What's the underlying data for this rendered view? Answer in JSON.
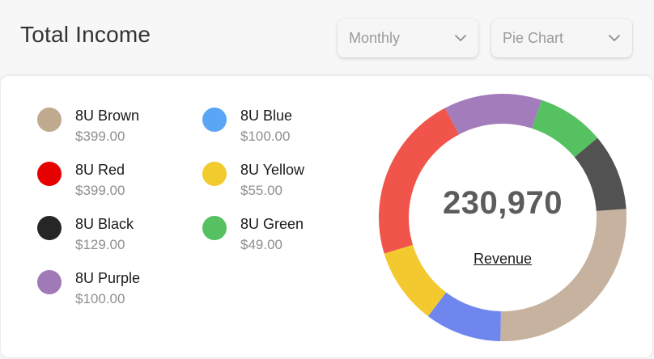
{
  "header": {
    "title": "Total Income"
  },
  "filters": {
    "period": "Monthly",
    "chart_type": "Pie Chart"
  },
  "legend": [
    {
      "name": "8U Brown",
      "price": "$399.00",
      "color": "#bfa98f"
    },
    {
      "name": "8U Red",
      "price": "$399.00",
      "color": "#e60000"
    },
    {
      "name": "8U Black",
      "price": "$129.00",
      "color": "#262626"
    },
    {
      "name": "8U Purple",
      "price": "$100.00",
      "color": "#a07ab7"
    },
    {
      "name": "8U Blue",
      "price": "$100.00",
      "color": "#5aa5f5"
    },
    {
      "name": "8U Yellow",
      "price": "$55.00",
      "color": "#f2cb2c"
    },
    {
      "name": "8U Green",
      "price": "$49.00",
      "color": "#55c160"
    }
  ],
  "donut": {
    "center_value": "230,970",
    "center_link": "Revenue",
    "slices": [
      {
        "name": "tan",
        "color": "#c6b29e",
        "fraction": 0.264
      },
      {
        "name": "blue",
        "color": "#6f86ef",
        "fraction": 0.1
      },
      {
        "name": "yellow",
        "color": "#f3c92f",
        "fraction": 0.1
      },
      {
        "name": "red",
        "color": "#f0544a",
        "fraction": 0.22
      },
      {
        "name": "purple",
        "color": "#a37dbb",
        "fraction": 0.128
      },
      {
        "name": "green",
        "color": "#55c160",
        "fraction": 0.088
      },
      {
        "name": "dark-gray",
        "color": "#525252",
        "fraction": 0.1
      }
    ]
  }
}
